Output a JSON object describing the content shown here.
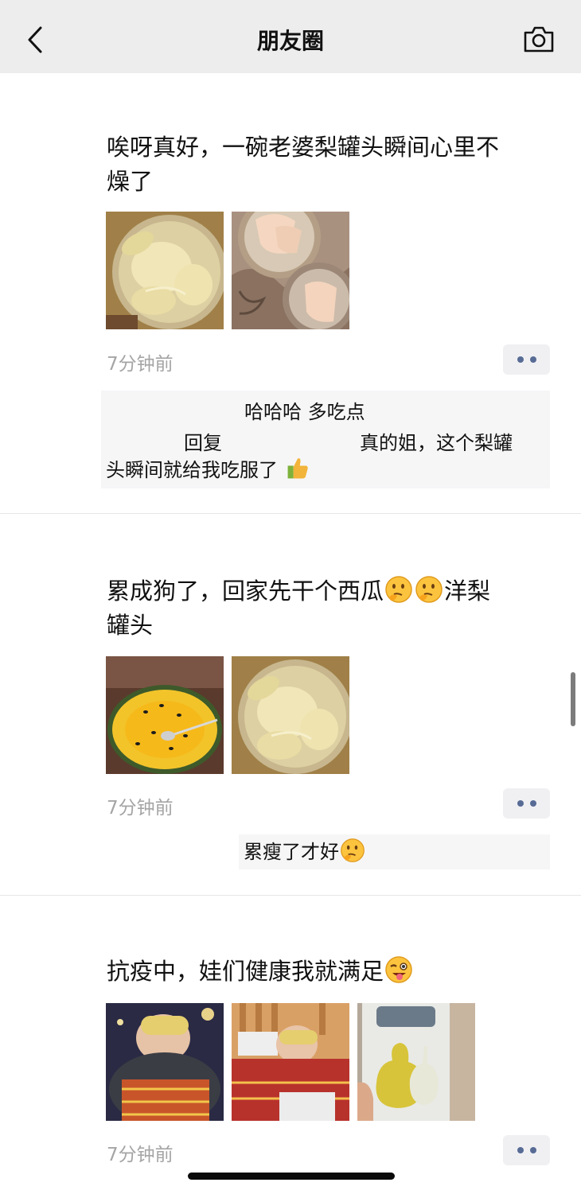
{
  "header": {
    "title": "朋友圈",
    "back_icon": "chevron-left-icon",
    "camera_icon": "camera-icon",
    "background": "#ededed"
  },
  "posts": [
    {
      "text_line1": "唉呀真好，一碗老婆梨罐头瞬间心里不",
      "text_line2": "燥了",
      "photos": [
        "canned-pear-photo",
        "pear-bowl-photo"
      ],
      "time": "7分钟前",
      "comments": [
        {
          "text": "哈哈哈 多吃点"
        },
        {
          "reply_word": "回复",
          "text_part1": "真的姐，这个梨罐",
          "text_part2": "头瞬间就给我吃服了",
          "emoji": "thumbs-up-icon"
        }
      ]
    },
    {
      "text_prefix": "累成狗了，回家先干个西瓜",
      "emojis": [
        "thinking-emoji",
        "thinking-emoji"
      ],
      "text_suffix": "洋梨",
      "text_line2": "罐头",
      "photos": [
        "yellow-watermelon-photo",
        "canned-pear-photo"
      ],
      "time": "7分钟前",
      "comments": [
        {
          "text": "累瘦了才好",
          "emoji": "thinking-emoji"
        }
      ]
    },
    {
      "text": "抗疫中，娃们健康我就满足",
      "emoji": "winking-tongue-emoji",
      "photos": [
        "child-eye-mask-photo",
        "child-sleeping-photo",
        "pear-can-label-photo"
      ],
      "time": "7分钟前"
    }
  ],
  "colors": {
    "link_blue": "#576b95",
    "time_gray": "#a5a5a5",
    "comment_bg": "#f6f6f7"
  }
}
